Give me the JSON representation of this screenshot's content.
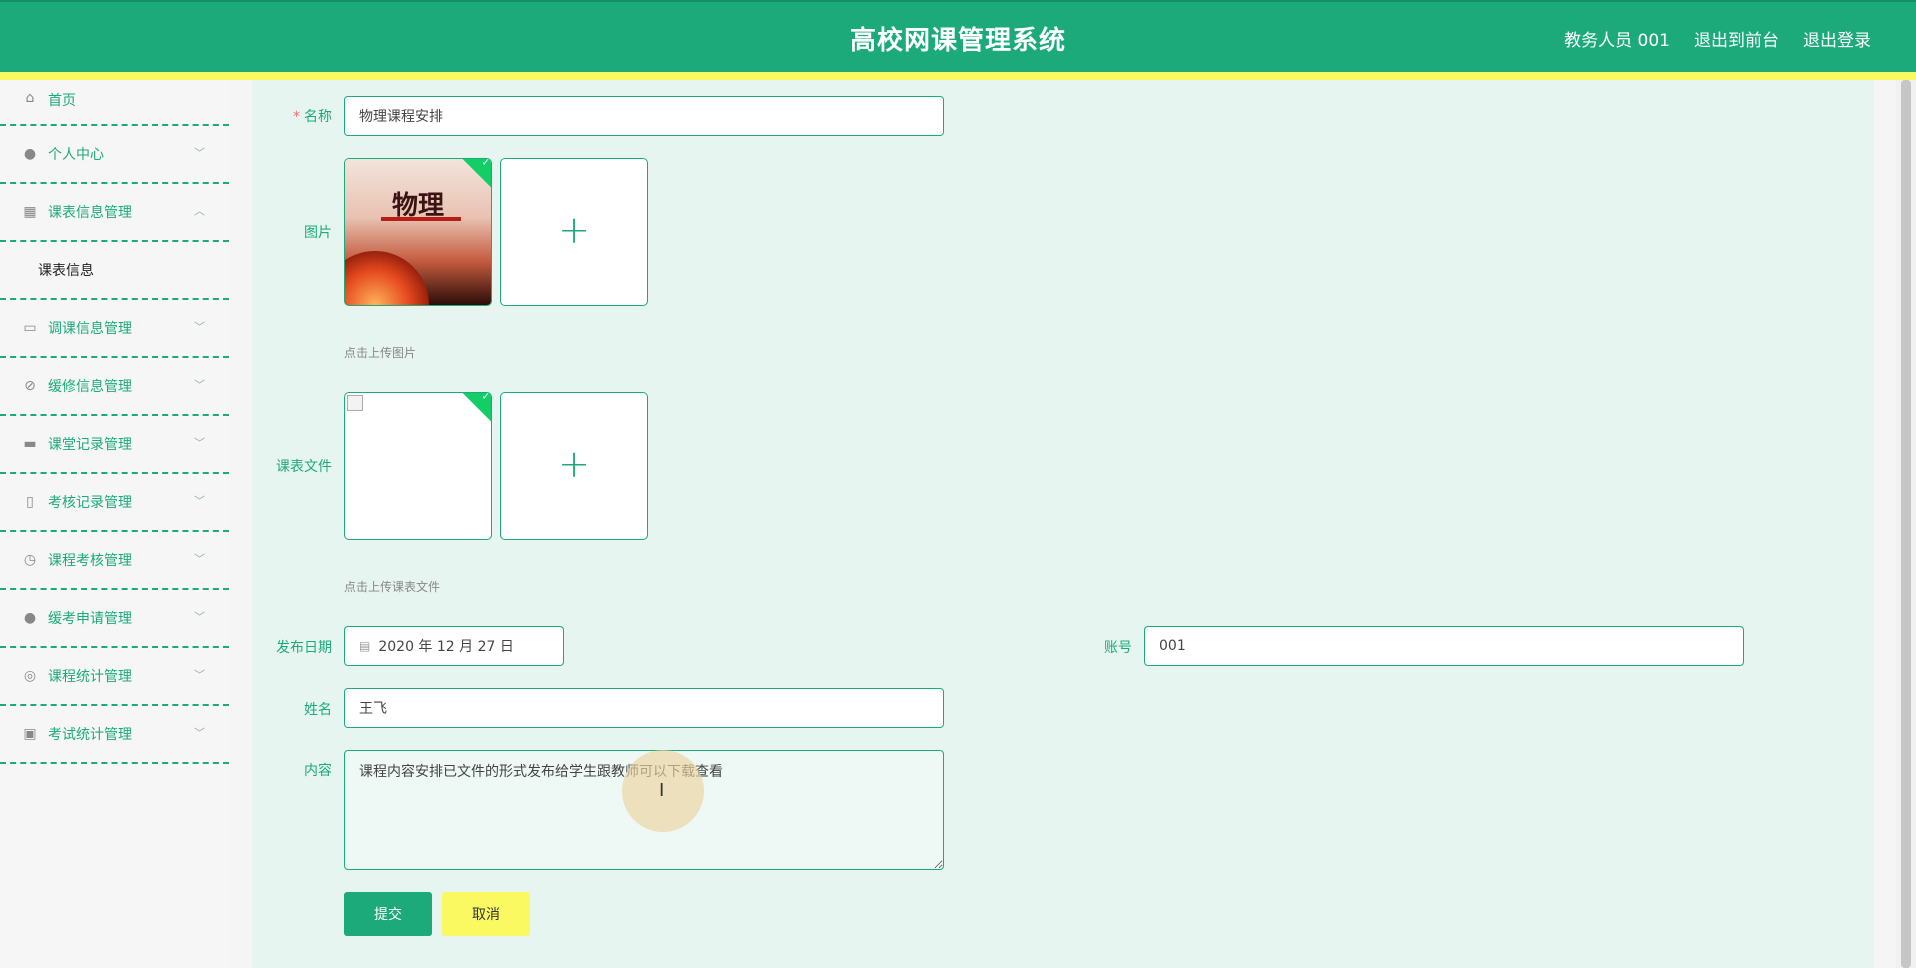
{
  "header": {
    "title": "高校网课管理系统",
    "user": "教务人员 001",
    "exit_front": "退出到前台",
    "logout": "退出登录"
  },
  "sidebar": {
    "items": [
      {
        "label": "首页",
        "icon": "home-icon"
      },
      {
        "label": "个人中心",
        "icon": "user-icon"
      },
      {
        "label": "课表信息管理",
        "icon": "grid-icon",
        "expanded": true,
        "sub": [
          "课表信息"
        ]
      },
      {
        "label": "调课信息管理",
        "icon": "wallet-icon"
      },
      {
        "label": "缓修信息管理",
        "icon": "bell-off-icon"
      },
      {
        "label": "课堂记录管理",
        "icon": "monitor-icon"
      },
      {
        "label": "考核记录管理",
        "icon": "mic-icon"
      },
      {
        "label": "课程考核管理",
        "icon": "clock-icon"
      },
      {
        "label": "缓考申请管理",
        "icon": "person-icon"
      },
      {
        "label": "课程统计管理",
        "icon": "compass-icon"
      },
      {
        "label": "考试统计管理",
        "icon": "apps-icon"
      }
    ]
  },
  "form": {
    "name_label": "名称",
    "name_value": "物理课程安排",
    "image_label": "图片",
    "image_hint": "点击上传图片",
    "book_title": "物理",
    "file_label": "课表文件",
    "file_hint": "点击上传课表文件",
    "date_label": "发布日期",
    "date_value": "2020 年 12 月 27 日",
    "account_label": "账号",
    "account_value": "001",
    "person_label": "姓名",
    "person_value": "王飞",
    "content_label": "内容",
    "content_value": "课程内容安排已文件的形式发布给学生跟教师可以下载查看",
    "submit": "提交",
    "cancel": "取消"
  },
  "colors": {
    "brand": "#1daa7b",
    "accent_yellow": "#fbf961",
    "main_bg": "#e6f5ef"
  }
}
